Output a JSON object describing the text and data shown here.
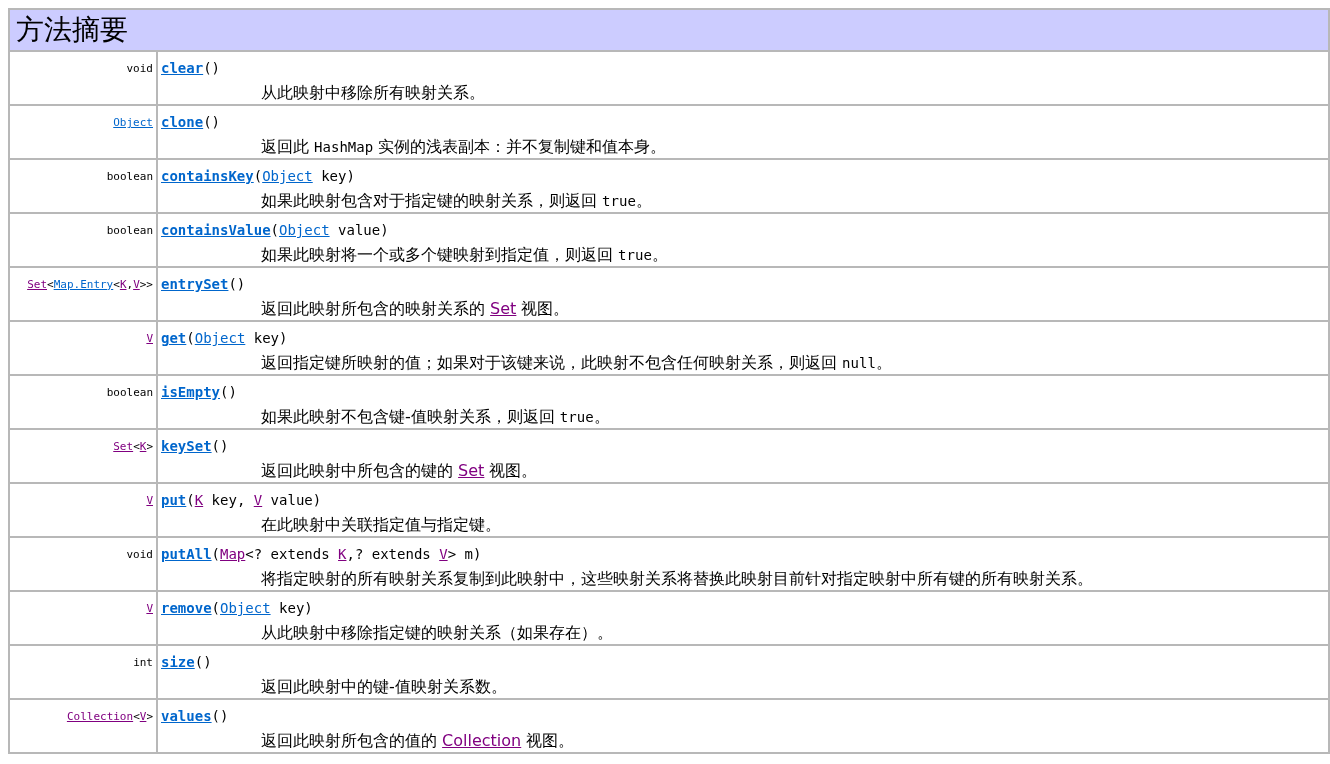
{
  "title": "方法摘要",
  "rows": [
    {
      "return_type": [
        {
          "text": "void",
          "kind": "text"
        }
      ],
      "signature": [
        {
          "text": "clear",
          "kind": "method"
        },
        {
          "text": "()",
          "kind": "text"
        }
      ],
      "description": [
        {
          "text": "从此映射中移除所有映射关系。",
          "kind": "text"
        }
      ]
    },
    {
      "return_type": [
        {
          "text": "Object",
          "kind": "link",
          "visited": false
        }
      ],
      "signature": [
        {
          "text": "clone",
          "kind": "method"
        },
        {
          "text": "()",
          "kind": "text"
        }
      ],
      "description": [
        {
          "text": "返回此 ",
          "kind": "text"
        },
        {
          "text": "HashMap",
          "kind": "code"
        },
        {
          "text": " 实例的浅表副本：并不复制键和值本身。",
          "kind": "text"
        }
      ]
    },
    {
      "return_type": [
        {
          "text": "boolean",
          "kind": "text"
        }
      ],
      "signature": [
        {
          "text": "containsKey",
          "kind": "method"
        },
        {
          "text": "(",
          "kind": "text"
        },
        {
          "text": "Object",
          "kind": "link",
          "visited": false
        },
        {
          "text": " key)",
          "kind": "text"
        }
      ],
      "description": [
        {
          "text": "如果此映射包含对于指定键的映射关系，则返回 ",
          "kind": "text"
        },
        {
          "text": "true",
          "kind": "code"
        },
        {
          "text": "。",
          "kind": "text"
        }
      ]
    },
    {
      "return_type": [
        {
          "text": "boolean",
          "kind": "text"
        }
      ],
      "signature": [
        {
          "text": "containsValue",
          "kind": "method"
        },
        {
          "text": "(",
          "kind": "text"
        },
        {
          "text": "Object",
          "kind": "link",
          "visited": false
        },
        {
          "text": " value)",
          "kind": "text"
        }
      ],
      "description": [
        {
          "text": "如果此映射将一个或多个键映射到指定值，则返回 ",
          "kind": "text"
        },
        {
          "text": "true",
          "kind": "code"
        },
        {
          "text": "。",
          "kind": "text"
        }
      ]
    },
    {
      "return_type": [
        {
          "text": "Set",
          "kind": "link",
          "visited": true
        },
        {
          "text": "<",
          "kind": "text"
        },
        {
          "text": "Map.Entry",
          "kind": "link",
          "visited": false
        },
        {
          "text": "<",
          "kind": "text"
        },
        {
          "text": "K",
          "kind": "link",
          "visited": true
        },
        {
          "text": ",",
          "kind": "text"
        },
        {
          "text": "V",
          "kind": "link",
          "visited": true
        },
        {
          "text": ">>",
          "kind": "text"
        }
      ],
      "signature": [
        {
          "text": "entrySet",
          "kind": "method"
        },
        {
          "text": "()",
          "kind": "text"
        }
      ],
      "description": [
        {
          "text": "返回此映射所包含的映射关系的 ",
          "kind": "text"
        },
        {
          "text": "Set",
          "kind": "link",
          "visited": true
        },
        {
          "text": " 视图。",
          "kind": "text"
        }
      ]
    },
    {
      "return_type": [
        {
          "text": "V",
          "kind": "link",
          "visited": true
        }
      ],
      "signature": [
        {
          "text": "get",
          "kind": "method"
        },
        {
          "text": "(",
          "kind": "text"
        },
        {
          "text": "Object",
          "kind": "link",
          "visited": false
        },
        {
          "text": " key)",
          "kind": "text"
        }
      ],
      "description": [
        {
          "text": "返回指定键所映射的值；如果对于该键来说，此映射不包含任何映射关系，则返回 ",
          "kind": "text"
        },
        {
          "text": "null",
          "kind": "code"
        },
        {
          "text": "。",
          "kind": "text"
        }
      ]
    },
    {
      "return_type": [
        {
          "text": "boolean",
          "kind": "text"
        }
      ],
      "signature": [
        {
          "text": "isEmpty",
          "kind": "method"
        },
        {
          "text": "()",
          "kind": "text"
        }
      ],
      "description": [
        {
          "text": "如果此映射不包含键-值映射关系，则返回 ",
          "kind": "text"
        },
        {
          "text": "true",
          "kind": "code"
        },
        {
          "text": "。",
          "kind": "text"
        }
      ]
    },
    {
      "return_type": [
        {
          "text": "Set",
          "kind": "link",
          "visited": true
        },
        {
          "text": "<",
          "kind": "text"
        },
        {
          "text": "K",
          "kind": "link",
          "visited": true
        },
        {
          "text": ">",
          "kind": "text"
        }
      ],
      "signature": [
        {
          "text": "keySet",
          "kind": "method"
        },
        {
          "text": "()",
          "kind": "text"
        }
      ],
      "description": [
        {
          "text": "返回此映射中所包含的键的 ",
          "kind": "text"
        },
        {
          "text": "Set",
          "kind": "link",
          "visited": true
        },
        {
          "text": " 视图。",
          "kind": "text"
        }
      ]
    },
    {
      "return_type": [
        {
          "text": "V",
          "kind": "link",
          "visited": true
        }
      ],
      "signature": [
        {
          "text": "put",
          "kind": "method"
        },
        {
          "text": "(",
          "kind": "text"
        },
        {
          "text": "K",
          "kind": "link",
          "visited": true
        },
        {
          "text": " key, ",
          "kind": "text"
        },
        {
          "text": "V",
          "kind": "link",
          "visited": true
        },
        {
          "text": " value)",
          "kind": "text"
        }
      ],
      "description": [
        {
          "text": "在此映射中关联指定值与指定键。",
          "kind": "text"
        }
      ]
    },
    {
      "return_type": [
        {
          "text": "void",
          "kind": "text"
        }
      ],
      "signature": [
        {
          "text": "putAll",
          "kind": "method"
        },
        {
          "text": "(",
          "kind": "text"
        },
        {
          "text": "Map",
          "kind": "link",
          "visited": true
        },
        {
          "text": "<? extends ",
          "kind": "text"
        },
        {
          "text": "K",
          "kind": "link",
          "visited": true
        },
        {
          "text": ",? extends ",
          "kind": "text"
        },
        {
          "text": "V",
          "kind": "link",
          "visited": true
        },
        {
          "text": "> m)",
          "kind": "text"
        }
      ],
      "description": [
        {
          "text": "将指定映射的所有映射关系复制到此映射中，这些映射关系将替换此映射目前针对指定映射中所有键的所有映射关系。",
          "kind": "text"
        }
      ]
    },
    {
      "return_type": [
        {
          "text": "V",
          "kind": "link",
          "visited": true
        }
      ],
      "signature": [
        {
          "text": "remove",
          "kind": "method"
        },
        {
          "text": "(",
          "kind": "text"
        },
        {
          "text": "Object",
          "kind": "link",
          "visited": false
        },
        {
          "text": " key)",
          "kind": "text"
        }
      ],
      "description": [
        {
          "text": "从此映射中移除指定键的映射关系（如果存在）。",
          "kind": "text"
        }
      ]
    },
    {
      "return_type": [
        {
          "text": "int",
          "kind": "text"
        }
      ],
      "signature": [
        {
          "text": "size",
          "kind": "method"
        },
        {
          "text": "()",
          "kind": "text"
        }
      ],
      "description": [
        {
          "text": "返回此映射中的键-值映射关系数。",
          "kind": "text"
        }
      ]
    },
    {
      "return_type": [
        {
          "text": "Collection",
          "kind": "link",
          "visited": true
        },
        {
          "text": "<",
          "kind": "text"
        },
        {
          "text": "V",
          "kind": "link",
          "visited": true
        },
        {
          "text": ">",
          "kind": "text"
        }
      ],
      "signature": [
        {
          "text": "values",
          "kind": "method"
        },
        {
          "text": "()",
          "kind": "text"
        }
      ],
      "description": [
        {
          "text": "返回此映射所包含的值的 ",
          "kind": "text"
        },
        {
          "text": "Collection",
          "kind": "link",
          "visited": true
        },
        {
          "text": " 视图。",
          "kind": "text"
        }
      ]
    }
  ]
}
